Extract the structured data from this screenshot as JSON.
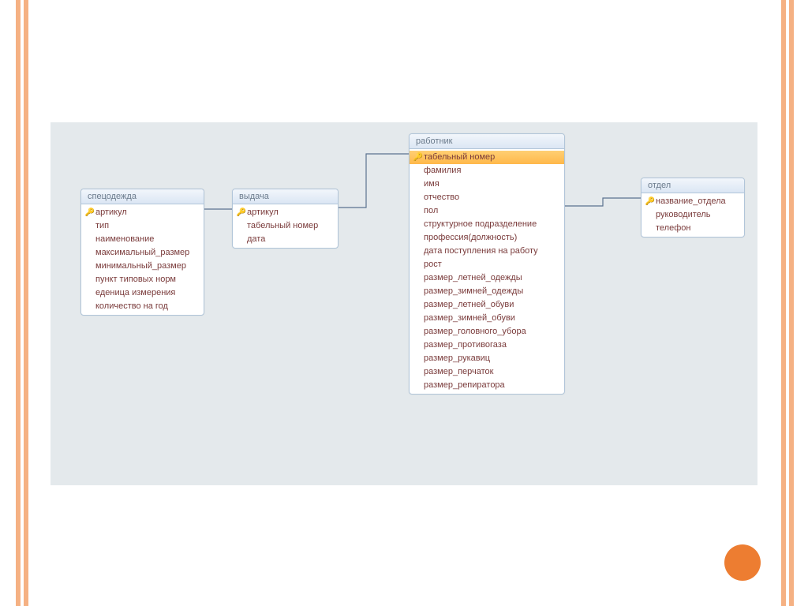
{
  "tables": {
    "specodezhda": {
      "title": "спецодежда",
      "fields": [
        {
          "key": true,
          "name": "артикул"
        },
        {
          "key": false,
          "name": "тип"
        },
        {
          "key": false,
          "name": "наименование"
        },
        {
          "key": false,
          "name": "максимальный_размер"
        },
        {
          "key": false,
          "name": "минимальный_размер"
        },
        {
          "key": false,
          "name": "пункт типовых норм"
        },
        {
          "key": false,
          "name": "еденица измерения"
        },
        {
          "key": false,
          "name": "количество на год"
        }
      ]
    },
    "vydacha": {
      "title": "выдача",
      "fields": [
        {
          "key": true,
          "name": "артикул"
        },
        {
          "key": false,
          "name": "табельный номер"
        },
        {
          "key": false,
          "name": "дата"
        }
      ]
    },
    "rabotnik": {
      "title": "работник",
      "fields": [
        {
          "key": true,
          "name": "табельный номер",
          "selected": true
        },
        {
          "key": false,
          "name": "фамилия"
        },
        {
          "key": false,
          "name": "имя"
        },
        {
          "key": false,
          "name": "отчество"
        },
        {
          "key": false,
          "name": "пол"
        },
        {
          "key": false,
          "name": "структурное подразделение"
        },
        {
          "key": false,
          "name": "профессия(должность)"
        },
        {
          "key": false,
          "name": "дата поступления на работу"
        },
        {
          "key": false,
          "name": "рост"
        },
        {
          "key": false,
          "name": "размер_летней_одежды"
        },
        {
          "key": false,
          "name": "размер_зимней_одежды"
        },
        {
          "key": false,
          "name": "размер_летней_обуви"
        },
        {
          "key": false,
          "name": "размер_зимней_обуви"
        },
        {
          "key": false,
          "name": "размер_головного_убора"
        },
        {
          "key": false,
          "name": "размер_противогаза"
        },
        {
          "key": false,
          "name": "размер_рукавиц"
        },
        {
          "key": false,
          "name": "размер_перчаток"
        },
        {
          "key": false,
          "name": "размер_репиратора"
        }
      ]
    },
    "otdel": {
      "title": "отдел",
      "fields": [
        {
          "key": true,
          "name": "название_отдела"
        },
        {
          "key": false,
          "name": "руководитель"
        },
        {
          "key": false,
          "name": "телефон"
        }
      ]
    }
  },
  "relationships": [
    {
      "from": "спецодежда.артикул",
      "to": "выдача.артикул"
    },
    {
      "from": "выдача.табельный номер",
      "to": "работник.табельный номер"
    },
    {
      "from": "работник.структурное подразделение",
      "to": "отдел.название_отдела"
    }
  ],
  "key_glyph": "🔑"
}
